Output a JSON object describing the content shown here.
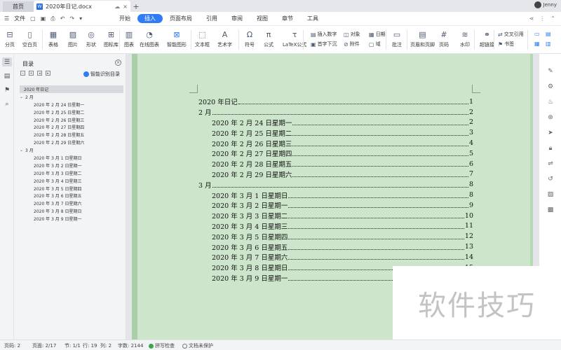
{
  "titlebar": {
    "home_tab": "首页",
    "doc_tab": "2020年日记.docx",
    "doc_badge": "W",
    "new_tab": "+",
    "user_name": "Jenny"
  },
  "menubar": {
    "file": "文件",
    "tabs": [
      "开始",
      "插入",
      "页面布局",
      "引用",
      "审阅",
      "视图",
      "章节",
      "工具"
    ],
    "active_tab": "插入"
  },
  "ribbon": {
    "items": [
      {
        "label": "分页",
        "icon": "page-break-icon"
      },
      {
        "label": "空白页",
        "icon": "blank-page-icon"
      },
      {
        "label": "表格",
        "icon": "table-icon"
      },
      {
        "label": "图片",
        "icon": "image-icon"
      },
      {
        "label": "形状",
        "icon": "shape-icon"
      },
      {
        "label": "图标库",
        "icon": "icon-library-icon"
      },
      {
        "label": "图表",
        "icon": "chart-icon"
      },
      {
        "label": "在线图表",
        "icon": "online-chart-icon"
      },
      {
        "label": "智能图形",
        "icon": "smart-art-icon"
      },
      {
        "label": "文本框",
        "icon": "textbox-icon"
      },
      {
        "label": "艺术字",
        "icon": "wordart-icon"
      },
      {
        "label": "符号",
        "icon": "symbol-icon"
      },
      {
        "label": "公式",
        "icon": "formula-icon"
      },
      {
        "label": "LaTeX公式",
        "icon": "latex-icon"
      },
      {
        "label": "批注",
        "icon": "comment-icon"
      },
      {
        "label": "页眉和页脚",
        "icon": "header-footer-icon"
      },
      {
        "label": "页码",
        "icon": "page-number-icon"
      },
      {
        "label": "水印",
        "icon": "watermark-icon"
      },
      {
        "label": "超链接",
        "icon": "hyperlink-icon"
      }
    ],
    "small": {
      "insert_number": "插入数字",
      "object": "对象",
      "date": "日期",
      "drop_cap": "首字下沉",
      "attachment": "附件",
      "field": "域",
      "cross_ref": "交叉引用",
      "bookmark": "书签"
    }
  },
  "toc_panel": {
    "title": "目录",
    "smart_toc": "智能识别目录",
    "items": [
      {
        "level": 0,
        "text": "2020 年日记"
      },
      {
        "level": 1,
        "text": "2 月"
      },
      {
        "level": 2,
        "text": "2020 年 2 月 24 日星期一"
      },
      {
        "level": 2,
        "text": "2020 年 2 月 25 日星期二"
      },
      {
        "level": 2,
        "text": "2020 年 2 月 26 日星期三"
      },
      {
        "level": 2,
        "text": "2020 年 2 月 27 日星期四"
      },
      {
        "level": 2,
        "text": "2020 年 2 月 28 日星期五"
      },
      {
        "level": 2,
        "text": "2020 年 2 月 29 日星期六"
      },
      {
        "level": 1,
        "text": "3 月"
      },
      {
        "level": 2,
        "text": "2020 年 3 月 1 日星期日"
      },
      {
        "level": 2,
        "text": "2020 年 3 月 2 日星期一"
      },
      {
        "level": 2,
        "text": "2020 年 3 月 3 日星期二"
      },
      {
        "level": 2,
        "text": "2020 年 3 月 4 日星期三"
      },
      {
        "level": 2,
        "text": "2020 年 3 月 5 日星期四"
      },
      {
        "level": 2,
        "text": "2020 年 3 月 6 日星期五"
      },
      {
        "level": 2,
        "text": "2020 年 3 月 7 日星期六"
      },
      {
        "level": 2,
        "text": "2020 年 3 月 8 日星期日"
      },
      {
        "level": 2,
        "text": "2020 年 3 月 9 日星期一"
      }
    ]
  },
  "document": {
    "toc_lines": [
      {
        "level": 1,
        "text": "2020 年日记",
        "page": "1"
      },
      {
        "level": 1,
        "text": "2 月",
        "page": "2"
      },
      {
        "level": 2,
        "text": "2020 年 2 月 24 日星期一",
        "page": "2"
      },
      {
        "level": 2,
        "text": "2020 年 2 月 25 日星期二",
        "page": "3"
      },
      {
        "level": 2,
        "text": "2020 年 2 月 26 日星期三",
        "page": "4"
      },
      {
        "level": 2,
        "text": "2020 年 2 月 27 日星期四",
        "page": "5"
      },
      {
        "level": 2,
        "text": "2020 年 2 月 28 日星期五",
        "page": "6"
      },
      {
        "level": 2,
        "text": "2020 年 2 月 29 日星期六",
        "page": "7"
      },
      {
        "level": 1,
        "text": "3 月",
        "page": "8"
      },
      {
        "level": 2,
        "text": "2020 年 3 月 1 日星期日",
        "page": "8"
      },
      {
        "level": 2,
        "text": "2020 年 3 月 2 日星期一",
        "page": "9"
      },
      {
        "level": 2,
        "text": "2020 年 3 月 3 日星期二",
        "page": "10"
      },
      {
        "level": 2,
        "text": "2020 年 3 月 4 日星期三",
        "page": "11"
      },
      {
        "level": 2,
        "text": "2020 年 3 月 5 日星期四",
        "page": "12"
      },
      {
        "level": 2,
        "text": "2020 年 3 月 6 日星期五",
        "page": "13"
      },
      {
        "level": 2,
        "text": "2020 年 3 月 7 日星期六",
        "page": "14"
      },
      {
        "level": 2,
        "text": "2020 年 3 月 8 日星期日",
        "page": "15"
      },
      {
        "level": 2,
        "text": "2020 年 3 月 9 日星期一",
        "page": "16"
      }
    ],
    "page_color": "#cde6cb"
  },
  "statusbar": {
    "page_num": "页码: 2",
    "pages": "页面: 2/17",
    "section": "节: 1/1",
    "row": "行: 19",
    "col": "列: 2",
    "words": "字数: 2144",
    "spell": "拼写检查",
    "protect": "文档未保护"
  },
  "watermark_text": "软件技巧",
  "colors": {
    "accent": "#2f7cf6",
    "page_green": "#cde6cb"
  }
}
